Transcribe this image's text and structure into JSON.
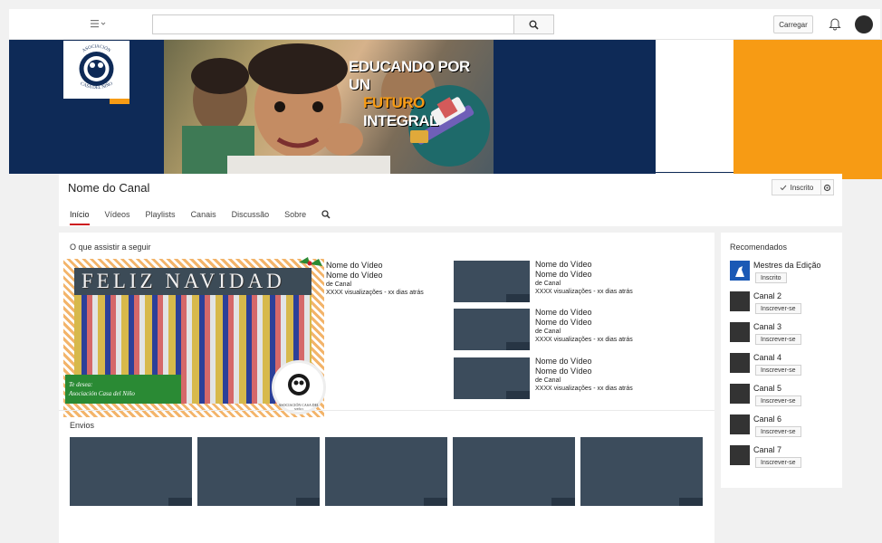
{
  "topbar": {
    "search_placeholder": "",
    "upload_label": "Carregar"
  },
  "banner": {
    "logo_text": "ASOCIACIÓN CASA DEL NIÑO",
    "hero_line1": "EDUCANDO POR UN",
    "hero_line2_highlight": "FUTURO",
    "hero_line2_rest": " INTEGRAL",
    "colors": {
      "navy": "#0e2a57",
      "orange": "#f79b14"
    }
  },
  "channel": {
    "name": "Nome do Canal",
    "subscribed_label": "Inscrito",
    "tabs": [
      {
        "label": "Início",
        "active": true
      },
      {
        "label": "Vídeos"
      },
      {
        "label": "Playlists"
      },
      {
        "label": "Canais"
      },
      {
        "label": "Discussão"
      },
      {
        "label": "Sobre"
      }
    ]
  },
  "main": {
    "watch_next_title": "O que assistir a seguir",
    "featured": {
      "card_title": "FELIZ NAVIDAD",
      "ribbon_line1": "Te desea:",
      "ribbon_line2": "Asociación Casa del Niño",
      "seal_text": "ASOCIACIÓN CASA DEL NIÑO",
      "video_name_1": "Nome do Vídeo",
      "video_name_2": "Nome do Vídeo",
      "channel": "de Canal",
      "meta": "XXXX visualizações - xx dias atrás"
    },
    "videos": [
      {
        "name1": "Nome do Vídeo",
        "name2": "Nome do Vídeo",
        "channel": "de Canal",
        "meta": "XXXX visualizações - xx dias atrás"
      },
      {
        "name1": "Nome do Vídeo",
        "name2": "Nome do Vídeo",
        "channel": "de Canal",
        "meta": "XXXX visualizações - xx dias atrás"
      },
      {
        "name1": "Nome do Vídeo",
        "name2": "Nome do Vídeo",
        "channel": "de Canal",
        "meta": "XXXX visualizações - xx dias atrás"
      }
    ],
    "uploads_title": "Envios"
  },
  "sidebar": {
    "title": "Recomendados",
    "items": [
      {
        "name": "Mestres da Edição",
        "button": "Inscrito"
      },
      {
        "name": "Canal 2",
        "button": "Inscrever-se"
      },
      {
        "name": "Canal 3",
        "button": "Inscrever-se"
      },
      {
        "name": "Canal 4",
        "button": "Inscrever-se"
      },
      {
        "name": "Canal 5",
        "button": "Inscrever-se"
      },
      {
        "name": "Canal 6",
        "button": "Inscrever-se"
      },
      {
        "name": "Canal 7",
        "button": "Inscrever-se"
      }
    ]
  }
}
